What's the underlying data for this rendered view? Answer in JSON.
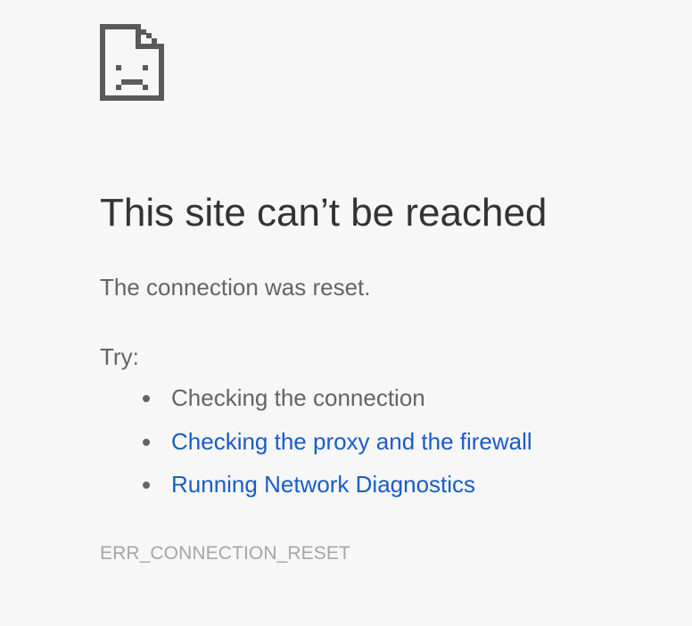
{
  "icon": {
    "name": "sad-page-icon",
    "color": "#5a5a5a"
  },
  "title": "This site can’t be reached",
  "summary": "The connection was reset.",
  "try_label": "Try:",
  "suggestions": [
    {
      "text": "Checking the connection",
      "link": false
    },
    {
      "text": "Checking the proxy and the firewall",
      "link": true
    },
    {
      "text": "Running Network Diagnostics",
      "link": true
    }
  ],
  "error_code": "ERR_CONNECTION_RESET",
  "colors": {
    "background": "#f7f7f7",
    "title": "#333333",
    "body_text": "#646464",
    "link": "#1a5cc8",
    "error_code": "#a6a6a6"
  }
}
